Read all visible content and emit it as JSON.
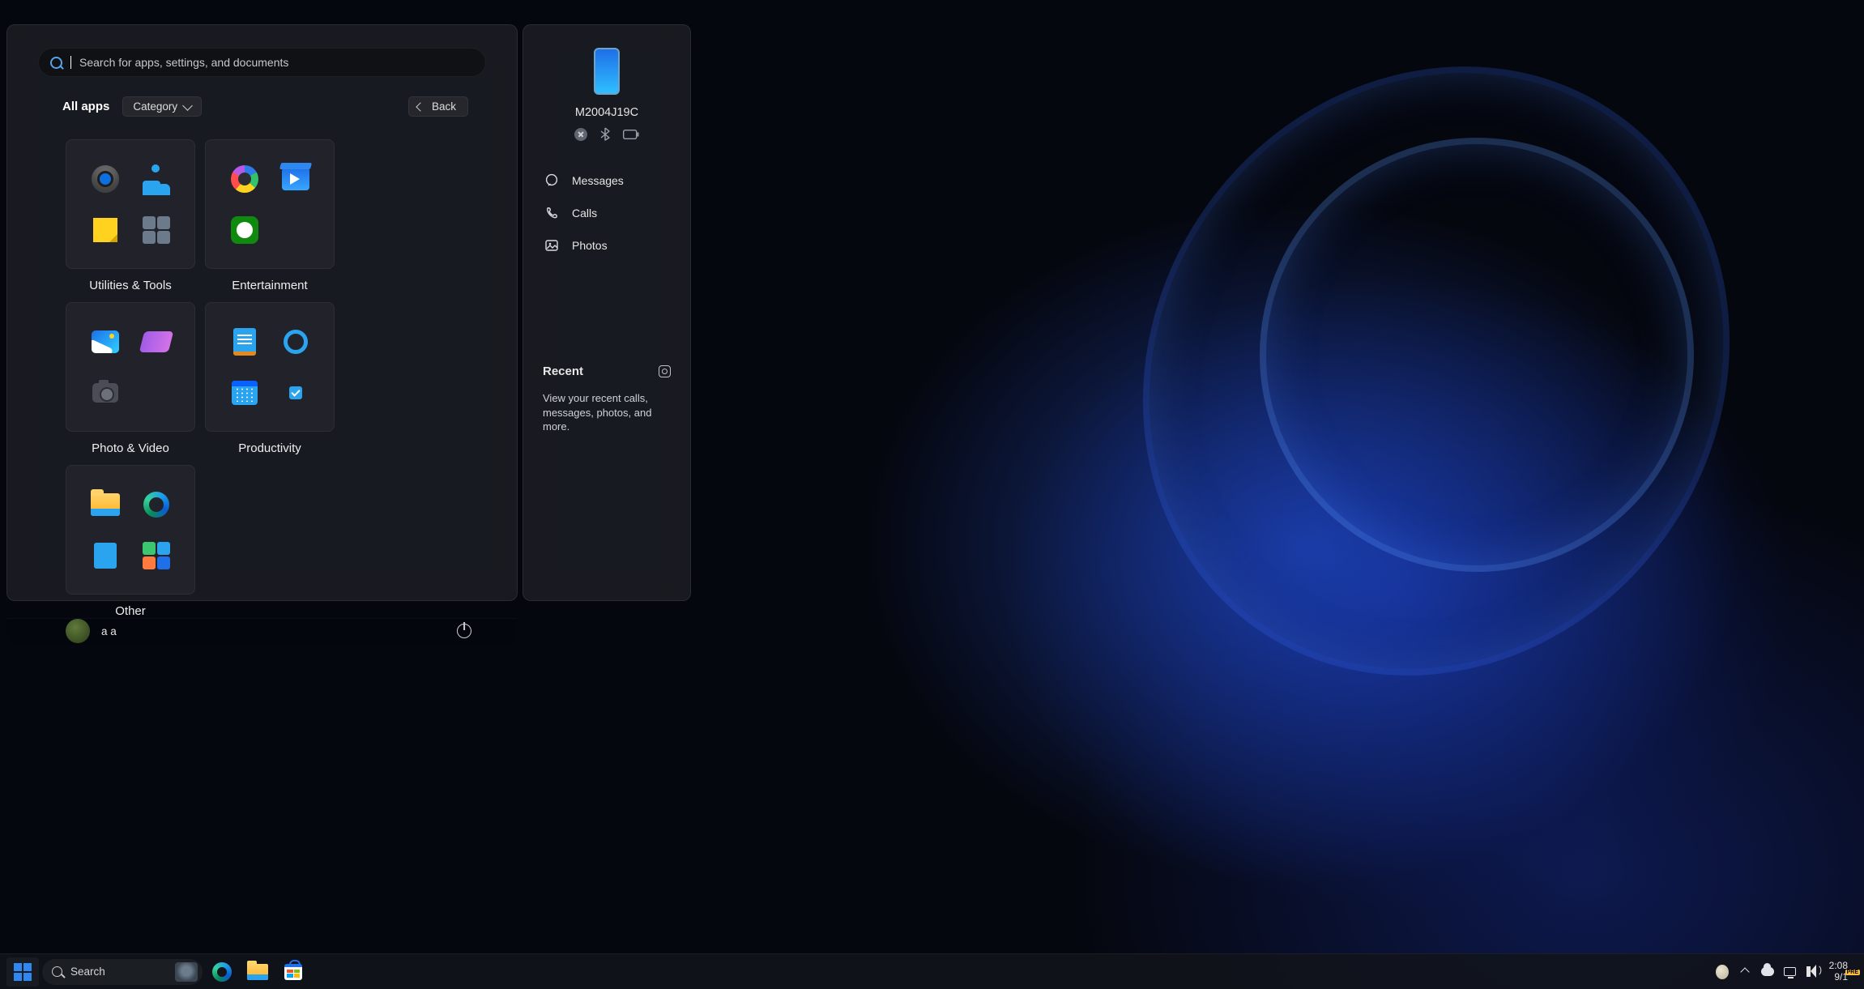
{
  "search": {
    "placeholder": "Search for apps, settings, and documents"
  },
  "header": {
    "all_apps": "All apps",
    "category": "Category",
    "back": "Back"
  },
  "categories": [
    {
      "label": "Utilities & Tools"
    },
    {
      "label": "Entertainment"
    },
    {
      "label": "Photo & Video"
    },
    {
      "label": "Productivity"
    },
    {
      "label": "Other"
    }
  ],
  "user": {
    "name": "a a"
  },
  "phone": {
    "device_name": "M2004J19C",
    "links": {
      "messages": "Messages",
      "calls": "Calls",
      "photos": "Photos"
    },
    "recent": {
      "title": "Recent",
      "desc": "View your recent calls, messages, photos, and more."
    }
  },
  "taskbar": {
    "search_label": "Search",
    "time": "2:08",
    "date": "9/1"
  }
}
